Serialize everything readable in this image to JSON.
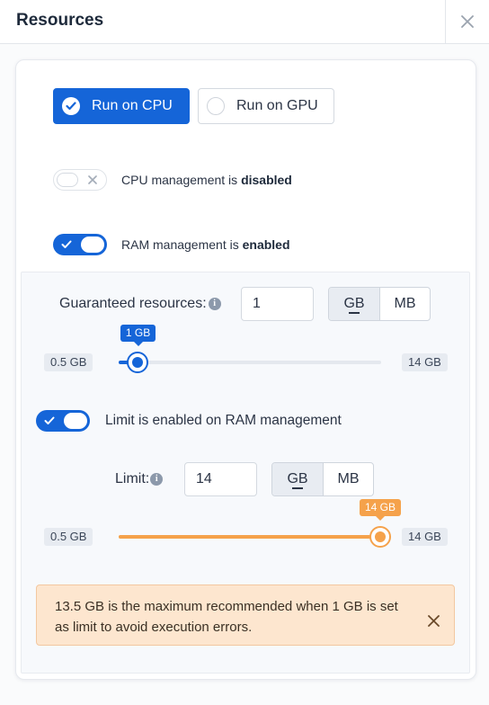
{
  "header": {
    "title": "Resources"
  },
  "processor": {
    "cpu_label": "Run on CPU",
    "gpu_label": "Run on GPU",
    "selected": "cpu",
    "accent": "#1565d8"
  },
  "cpu_management": {
    "prefix": "CPU management is ",
    "state": "disabled",
    "enabled": false
  },
  "ram_management": {
    "prefix": "RAM management is ",
    "state": "enabled",
    "enabled": true
  },
  "guaranteed": {
    "label": "Guaranteed resources:",
    "info_icon": "info-icon",
    "value": "1",
    "units": [
      "GB",
      "MB"
    ],
    "selected_unit": "GB",
    "slider": {
      "min_label": "0.5 GB",
      "max_label": "14 GB",
      "value_label": "1 GB",
      "min": 0.5,
      "max": 14,
      "value": 1,
      "color": "#1565d8"
    }
  },
  "limit_toggle": {
    "label": "Limit is enabled on RAM management",
    "enabled": true
  },
  "limit": {
    "label": "Limit:",
    "info_icon": "info-icon",
    "value": "14",
    "units": [
      "GB",
      "MB"
    ],
    "selected_unit": "GB",
    "slider": {
      "min_label": "0.5 GB",
      "max_label": "14 GB",
      "value_label": "14 GB",
      "min": 0.5,
      "max": 14,
      "value": 14,
      "color": "#f5a24b"
    }
  },
  "warning": {
    "text": "13.5 GB is the maximum recommended when 1 GB is set as limit to avoid execution errors.",
    "bg": "#fde6cf"
  }
}
